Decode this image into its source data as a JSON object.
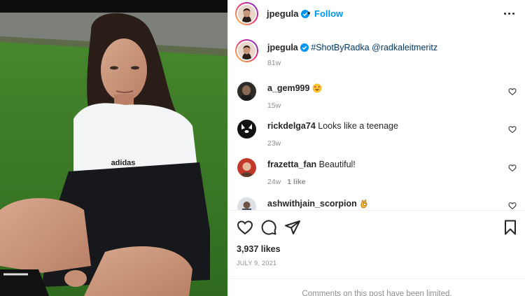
{
  "post": {
    "username": "jpegula",
    "follow_label": "Follow",
    "separator": "•",
    "caption_username": "jpegula",
    "caption_hashtag": "#ShotByRadka",
    "caption_mention": "@radkaleitmeritz",
    "caption_time": "81w",
    "likes": "3,937 likes",
    "date": "JULY 9, 2021",
    "comments_limited": "Comments on this post have been limited."
  },
  "comments": [
    {
      "username": "a_gem999",
      "text": "",
      "emoji": "heart-eyes-emoji",
      "time": "15w",
      "likes": ""
    },
    {
      "username": "rickdelga74",
      "text": "Looks like a teenage",
      "time": "23w",
      "likes": ""
    },
    {
      "username": "frazetta_fan",
      "text": "Beautiful!",
      "time": "24w",
      "likes": "1 like"
    },
    {
      "username": "ashwithjain_scorpion",
      "text": "",
      "emoji": "ok-hand-emoji",
      "time": "",
      "likes": ""
    }
  ],
  "icons": {
    "verified": "verified-badge-icon",
    "more": "more-options-icon",
    "like": "heart-icon",
    "comment": "comment-icon",
    "share": "send-icon",
    "save": "bookmark-icon"
  },
  "colors": {
    "link": "#00376b",
    "follow": "#0095f6",
    "verified": "#0095f6",
    "muted": "#8e8e8e",
    "grass": "#3f7d29"
  },
  "photo": {
    "brand_text": "adidas"
  }
}
